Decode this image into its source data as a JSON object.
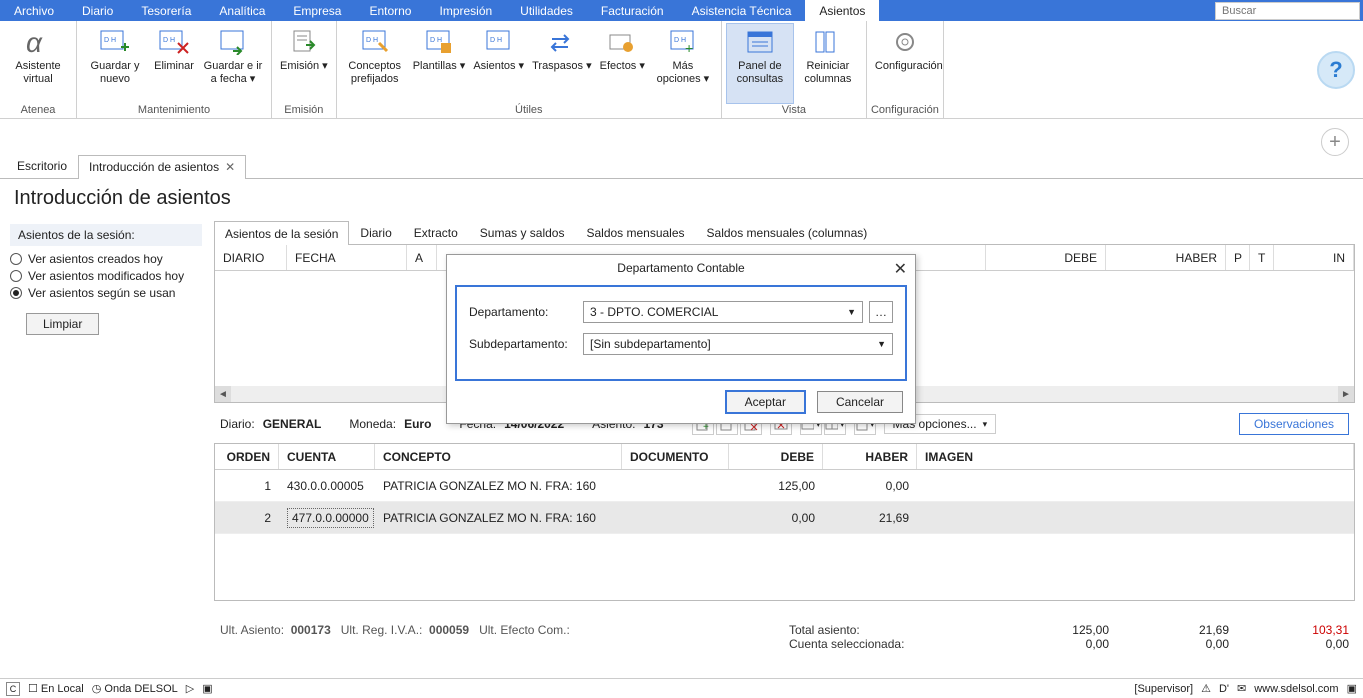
{
  "menu": [
    "Archivo",
    "Diario",
    "Tesorería",
    "Analítica",
    "Empresa",
    "Entorno",
    "Impresión",
    "Utilidades",
    "Facturación",
    "Asistencia Técnica",
    "Asientos"
  ],
  "menu_active": 10,
  "search_placeholder": "Buscar",
  "ribbon": {
    "groups": [
      {
        "label": "Atenea",
        "buttons": [
          {
            "name": "asistente-virtual",
            "txt": "Asistente virtual"
          }
        ]
      },
      {
        "label": "Mantenimiento",
        "buttons": [
          {
            "name": "guardar-y-nuevo",
            "txt": "Guardar y nuevo"
          },
          {
            "name": "eliminar",
            "txt": "Eliminar"
          },
          {
            "name": "guardar-ir-a-fecha",
            "txt": "Guardar e ir a fecha ▾"
          }
        ]
      },
      {
        "label": "Emisión",
        "buttons": [
          {
            "name": "emision",
            "txt": "Emisión ▾"
          }
        ]
      },
      {
        "label": "Útiles",
        "buttons": [
          {
            "name": "conceptos-prefijados",
            "txt": "Conceptos prefijados"
          },
          {
            "name": "plantillas",
            "txt": "Plantillas ▾"
          },
          {
            "name": "asientos",
            "txt": "Asientos ▾"
          },
          {
            "name": "traspasos",
            "txt": "Traspasos ▾"
          },
          {
            "name": "efectos",
            "txt": "Efectos ▾"
          },
          {
            "name": "mas-opciones",
            "txt": "Más opciones ▾"
          }
        ]
      },
      {
        "label": "Vista",
        "buttons": [
          {
            "name": "panel-de-consultas",
            "txt": "Panel de consultas",
            "active": true
          },
          {
            "name": "reiniciar-columnas",
            "txt": "Reiniciar columnas"
          }
        ]
      },
      {
        "label": "Configuración",
        "buttons": [
          {
            "name": "configuracion",
            "txt": "Configuración"
          }
        ]
      }
    ]
  },
  "doc_tabs": [
    {
      "label": "Escritorio",
      "close": false
    },
    {
      "label": "Introducción de asientos",
      "close": true,
      "active": true
    }
  ],
  "page_title": "Introducción de asientos",
  "left_panel": {
    "header": "Asientos de la sesión:",
    "radios": [
      {
        "label": "Ver asientos creados hoy",
        "sel": false
      },
      {
        "label": "Ver asientos modificados hoy",
        "sel": false
      },
      {
        "label": "Ver asientos según se usan",
        "sel": true
      }
    ],
    "clear_btn": "Limpiar"
  },
  "sub_tabs": [
    "Asientos de la sesión",
    "Diario",
    "Extracto",
    "Sumas y saldos",
    "Saldos mensuales",
    "Saldos mensuales (columnas)"
  ],
  "sub_tab_active": 0,
  "grid1_cols": [
    "DIARIO",
    "FECHA",
    "A",
    "DEBE",
    "HABER",
    "P",
    "T",
    "IN"
  ],
  "info": {
    "diario_lbl": "Diario:",
    "diario_val": "GENERAL",
    "moneda_lbl": "Moneda:",
    "moneda_val": "Euro",
    "fecha_lbl": "Fecha:",
    "fecha_val": "14/06/2022",
    "asiento_lbl": "Asiento:",
    "asiento_val": "173",
    "more_opts": "Más opciones...",
    "obs": "Observaciones"
  },
  "grid2_cols": [
    "ORDEN",
    "CUENTA",
    "CONCEPTO",
    "DOCUMENTO",
    "DEBE",
    "HABER",
    "IMAGEN"
  ],
  "grid2_rows": [
    {
      "orden": "1",
      "cuenta": "430.0.0.00005",
      "concepto": "PATRICIA GONZALEZ MO N. FRA:  160",
      "doc": "",
      "debe": "125,00",
      "haber": "0,00"
    },
    {
      "orden": "2",
      "cuenta": "477.0.0.00000",
      "concepto": "PATRICIA GONZALEZ MO N. FRA:  160",
      "doc": "",
      "debe": "0,00",
      "haber": "21,69",
      "sel": true,
      "boxed": true
    }
  ],
  "totals": {
    "ult_asiento_lbl": "Ult. Asiento:",
    "ult_asiento_val": "000173",
    "ult_reg_lbl": "Ult. Reg. I.V.A.:",
    "ult_reg_val": "000059",
    "ult_efecto_lbl": "Ult. Efecto Com.:",
    "total_lbl": "Total asiento:",
    "total_debe": "125,00",
    "total_haber": "21,69",
    "total_diff": "103,31",
    "cuenta_lbl": "Cuenta seleccionada:",
    "cuenta_debe": "0,00",
    "cuenta_haber": "0,00",
    "cuenta_diff": "0,00"
  },
  "dialog": {
    "title": "Departamento Contable",
    "dept_lbl": "Departamento:",
    "dept_val": "3 - DPTO. COMERCIAL",
    "sub_lbl": "Subdepartamento:",
    "sub_val": "[Sin subdepartamento]",
    "accept": "Aceptar",
    "cancel": "Cancelar"
  },
  "status": {
    "local": "En Local",
    "onda": "Onda DELSOL",
    "supervisor": "[Supervisor]",
    "url": "www.sdelsol.com"
  }
}
